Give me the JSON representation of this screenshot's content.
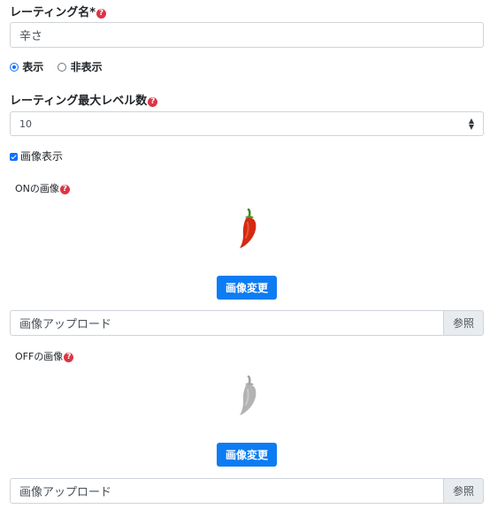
{
  "rating_name": {
    "label": "レーティング名",
    "required_mark": "*",
    "help": "?",
    "value": "辛さ"
  },
  "visibility": {
    "show_label": "表示",
    "hide_label": "非表示",
    "selected": "show"
  },
  "max_level": {
    "label": "レーティング最大レベル数",
    "help": "?",
    "value": "10"
  },
  "image_display": {
    "label": "画像表示",
    "checked": true
  },
  "on_image": {
    "label": "ONの画像",
    "help": "?",
    "change_button": "画像変更",
    "upload_placeholder": "画像アップロード",
    "browse_button": "参照"
  },
  "off_image": {
    "label": "OFFの画像",
    "help": "?",
    "change_button": "画像変更",
    "upload_placeholder": "画像アップロード",
    "browse_button": "参照"
  },
  "colors": {
    "accent": "#0d7cf2",
    "help": "#dc3545",
    "chili_on": "#d42a12",
    "chili_off": "#b3b3b3"
  }
}
